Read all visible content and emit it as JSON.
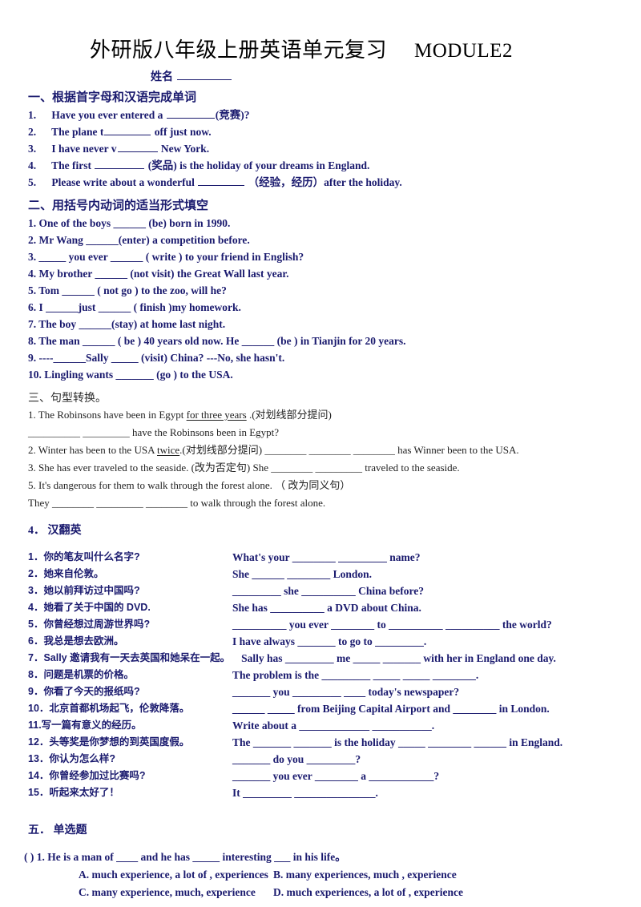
{
  "document": {
    "title_cn": "外研版八年级上册英语单元复习",
    "title_module": "MODULE2",
    "name_label": "姓名"
  },
  "section1": {
    "heading": "一、根据首字母和汉语完成单词",
    "items": [
      {
        "num": "1.",
        "pre": "Have you ever entered a",
        "blank": 1,
        "post": "(竞赛)?"
      },
      {
        "num": "2.",
        "pre": "The plane t",
        "blank": 1,
        "post": "off just now."
      },
      {
        "num": "3.",
        "pre": "I have never v",
        "blank": 1,
        "post": "New York."
      },
      {
        "num": "4.",
        "pre": "The first",
        "blank": 1,
        "post": "(奖品) is the holiday of your dreams in England."
      },
      {
        "num": "5.",
        "pre": "Please write about a wonderful",
        "blank": 1,
        "post": "（经验，经历）after the holiday."
      }
    ]
  },
  "section2": {
    "heading": "二、用括号内动词的适当形式填空",
    "items": [
      "1. One of the boys ______ (be) born in 1990.",
      "2. Mr Wang ______(enter) a competition before.",
      "3. _____ you ever ______ ( write ) to your friend in English?",
      "4. My brother ______ (not visit) the Great Wall last year.",
      "5. Tom ______ ( not go ) to the zoo, will he?",
      "6. I ______just ______ ( finish )my homework.",
      "7. The boy ______(stay) at home last night.",
      "8. The man ______ ( be ) 40 years old now. He ______ (be ) in Tianjin for 20 years.",
      "9. ----______Sally _____ (visit) China?   ---No, she hasn't.",
      "10. Lingling wants _______ (go ) to the USA."
    ]
  },
  "section3": {
    "heading": "三、句型转换。",
    "items": [
      {
        "text_a": "1. The Robinsons have been in Egypt ",
        "underlined": "for three years",
        "text_b": " .(对划线部分提问)"
      },
      {
        "text_a": "__________ _________ have the Robinsons been in Egypt?"
      },
      {
        "text_a": "2. Winter has been to the USA ",
        "underlined": "twice",
        "text_b": ".(对划线部分提问)   ________ ________ ________ has Winner been to the USA."
      },
      {
        "text_a": "3. She has ever traveled to the seaside. (改为否定句)     She ________ _________ traveled to the seaside."
      },
      {
        "text_a": "5. It's dangerous for them to walk through the forest alone.  （ 改为同义句）"
      },
      {
        "text_a": "They ________ _________ ________ to walk through the forest alone."
      }
    ]
  },
  "section4": {
    "heading": "4．  汉翻英",
    "items": [
      {
        "cn": "1．你的笔友叫什么名字?",
        "en": "What's your ________ _________ name?"
      },
      {
        "cn": "2．她来自伦敦。",
        "en": "She ______   ________ London."
      },
      {
        "cn": "3．她以前拜访过中国吗?",
        "en": "_________ she __________ China before?"
      },
      {
        "cn": "4．她看了关于中国的 DVD.",
        "en": "She has __________ a DVD about China."
      },
      {
        "cn": "5．你曾经想过周游世界吗?",
        "en": "__________ you ever ________ to __________  __________ the world?"
      },
      {
        "cn": "6．我总是想去欧洲。",
        "en": "I have always _______ to go to _________."
      },
      {
        "cn": "7．Sally  邀请我有一天去英国和她呆在一起。",
        "en": "Sally has _________ me _____ _______ with her in England one day.",
        "wide": true
      },
      {
        "cn": "8．问题是机票的价格。",
        "en": "The problem is the _________ _____ _____ ________."
      },
      {
        "cn": "9．你看了今天的报纸吗?",
        "en": "_______ you _________ ____ today's newspaper?"
      },
      {
        "cn": "10．北京首都机场起飞，伦敦降落。",
        "en": "______ _____ from Beijing Capital Airport and ________ in London."
      },
      {
        "cn": "11.写一篇有意义的经历。",
        "en": "Write about a _____________ ___________."
      },
      {
        "cn": "12．头等奖是你梦想的到英国度假。",
        "en": "The _______ _______ is the holiday _____ ________ ______ in England."
      },
      {
        "cn": "13．你认为怎么样?",
        "en": "_______ do you _________?"
      },
      {
        "cn": "14．你曾经参加过比赛吗?",
        "en": "_______ you ever ________ a ____________?"
      },
      {
        "cn": "15．听起来太好了！",
        "en": "It _________ _______________."
      }
    ]
  },
  "section5": {
    "heading": "五．  单选题",
    "question": {
      "bracket": "(    ) 1.",
      "stem": "He is a man of ____ and he has _____ interesting ___ in his life。",
      "options": [
        "A. much experience, a lot of , experiences",
        "B. many experiences, much , experience",
        "C. many experience, much, experience",
        "D. much experiences, a lot of , experience"
      ]
    }
  }
}
